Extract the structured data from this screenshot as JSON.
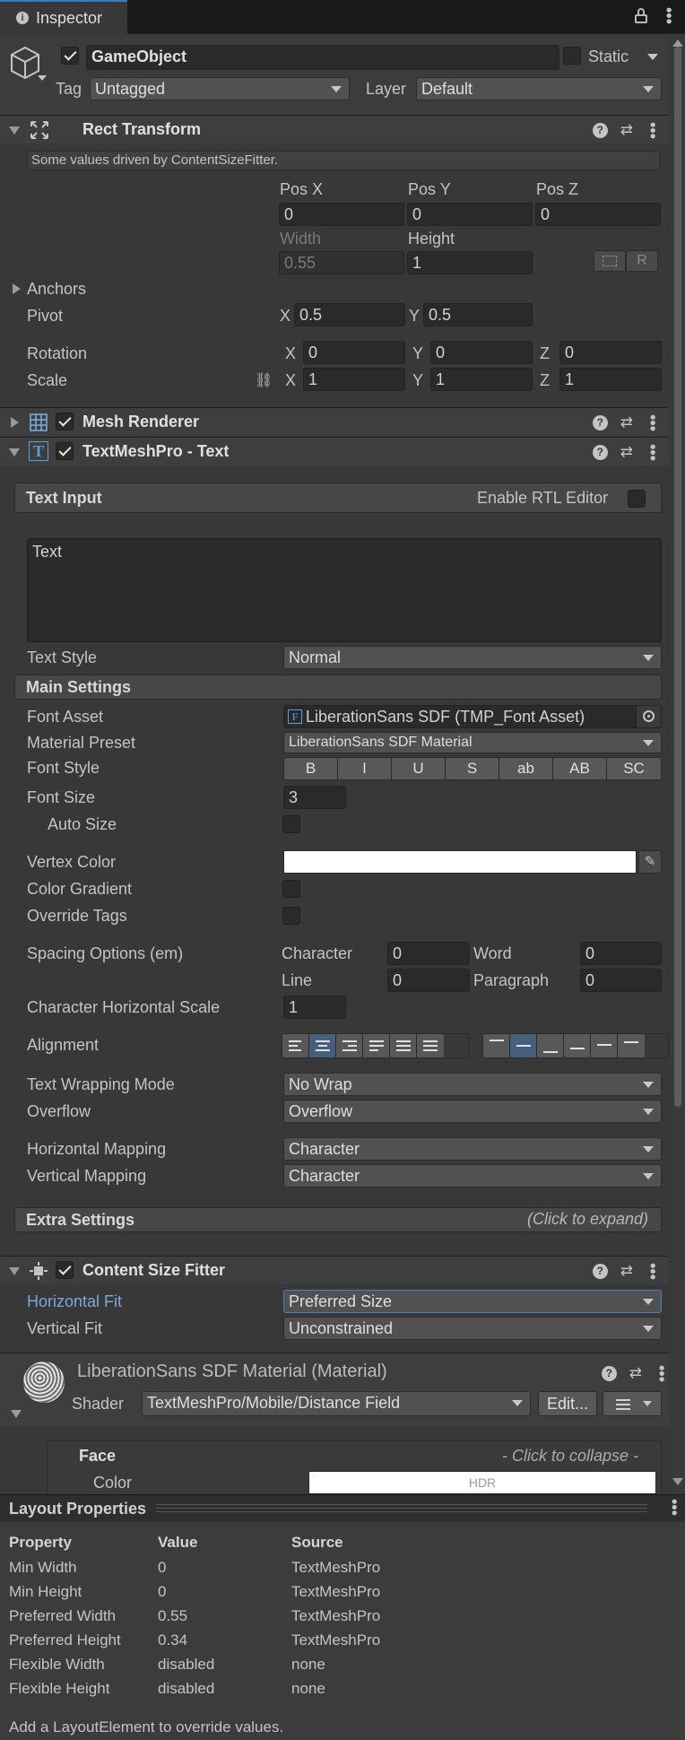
{
  "tab": {
    "title": "Inspector"
  },
  "gameobject": {
    "name": "GameObject",
    "static_label": "Static",
    "tag_label": "Tag",
    "tag_value": "Untagged",
    "layer_label": "Layer",
    "layer_value": "Default"
  },
  "rect_transform": {
    "title": "Rect Transform",
    "notice": "Some values driven by ContentSizeFitter.",
    "pos_x_label": "Pos X",
    "pos_y_label": "Pos Y",
    "pos_z_label": "Pos Z",
    "pos_x": "0",
    "pos_y": "0",
    "pos_z": "0",
    "width_label": "Width",
    "height_label": "Height",
    "width": "0.55",
    "height": "1",
    "raw_btn": "R",
    "anchors_label": "Anchors",
    "pivot_label": "Pivot",
    "pivot_x_label": "X",
    "pivot_x": "0.5",
    "pivot_y_label": "Y",
    "pivot_y": "0.5",
    "rotation_label": "Rotation",
    "rot_x": "0",
    "rot_y": "0",
    "rot_z": "0",
    "scale_label": "Scale",
    "scale_x": "1",
    "scale_y": "1",
    "scale_z": "1",
    "x_label": "X",
    "y_label": "Y",
    "z_label": "Z"
  },
  "mesh_renderer": {
    "title": "Mesh Renderer"
  },
  "tmp": {
    "title": "TextMeshPro - Text",
    "text_input_label": "Text Input",
    "rtl_label": "Enable RTL Editor",
    "text_value": "Text",
    "text_style_label": "Text Style",
    "text_style_value": "Normal",
    "main_settings": "Main Settings",
    "font_asset_label": "Font Asset",
    "font_asset_value": "LiberationSans SDF (TMP_Font Asset)",
    "material_preset_label": "Material Preset",
    "material_preset_value": "LiberationSans SDF Material",
    "font_style_label": "Font Style",
    "font_style_buttons": [
      "B",
      "I",
      "U",
      "S",
      "ab",
      "AB",
      "SC"
    ],
    "font_size_label": "Font Size",
    "font_size_value": "3",
    "auto_size_label": "Auto Size",
    "vertex_color_label": "Vertex Color",
    "vertex_color": "#ffffff",
    "color_gradient_label": "Color Gradient",
    "override_tags_label": "Override Tags",
    "spacing_label": "Spacing Options (em)",
    "character_label": "Character",
    "character_value": "0",
    "word_label": "Word",
    "word_value": "0",
    "line_label": "Line",
    "line_value": "0",
    "paragraph_label": "Paragraph",
    "paragraph_value": "0",
    "char_hscale_label": "Character Horizontal Scale",
    "char_hscale_value": "1",
    "alignment_label": "Alignment",
    "wrapping_label": "Text Wrapping Mode",
    "wrapping_value": "No Wrap",
    "overflow_label": "Overflow",
    "overflow_value": "Overflow",
    "hmapping_label": "Horizontal Mapping",
    "hmapping_value": "Character",
    "vmapping_label": "Vertical Mapping",
    "vmapping_value": "Character",
    "extra_settings": "Extra Settings",
    "extra_hint": "(Click to expand)"
  },
  "csf": {
    "title": "Content Size Fitter",
    "hfit_label": "Horizontal Fit",
    "hfit_value": "Preferred Size",
    "vfit_label": "Vertical Fit",
    "vfit_value": "Unconstrained"
  },
  "material": {
    "title": "LiberationSans SDF Material (Material)",
    "shader_label": "Shader",
    "shader_value": "TextMeshPro/Mobile/Distance Field",
    "edit_btn": "Edit...",
    "face_label": "Face",
    "face_hint": "- Click to collapse -",
    "color_label": "Color",
    "hdr_label": "HDR"
  },
  "layout_props": {
    "title": "Layout Properties",
    "headers": {
      "property": "Property",
      "value": "Value",
      "source": "Source"
    },
    "rows": [
      {
        "property": "Min Width",
        "value": "0",
        "source": "TextMeshPro"
      },
      {
        "property": "Min Height",
        "value": "0",
        "source": "TextMeshPro"
      },
      {
        "property": "Preferred Width",
        "value": "0.55",
        "source": "TextMeshPro"
      },
      {
        "property": "Preferred Height",
        "value": "0.34",
        "source": "TextMeshPro"
      },
      {
        "property": "Flexible Width",
        "value": "disabled",
        "source": "none"
      },
      {
        "property": "Flexible Height",
        "value": "disabled",
        "source": "none"
      }
    ],
    "footer": "Add a LayoutElement to override values."
  },
  "colors": {
    "accent": "#46607c",
    "label_highlight": "#7ea7d8"
  }
}
